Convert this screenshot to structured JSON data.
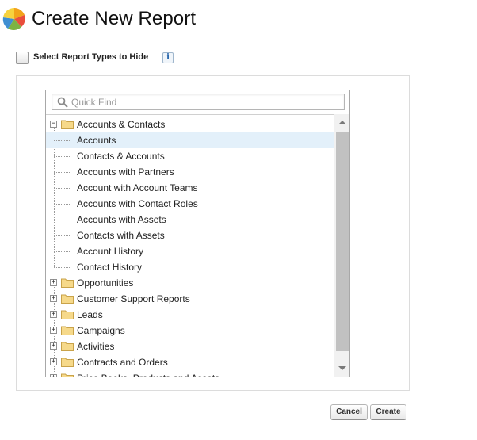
{
  "header": {
    "title": "Create New Report",
    "logo_icon": "salesforce-reports-logo"
  },
  "hide_types": {
    "label": "Select Report Types to Hide",
    "checked": false,
    "info_icon": "i"
  },
  "search": {
    "placeholder": "Quick Find",
    "value": "",
    "icon": "search-icon"
  },
  "tree": [
    {
      "label": "Accounts & Contacts",
      "type": "folder",
      "expanded": true,
      "expander": "−"
    },
    {
      "label": "Accounts",
      "type": "item",
      "selected": true
    },
    {
      "label": "Contacts & Accounts",
      "type": "item"
    },
    {
      "label": "Accounts with Partners",
      "type": "item"
    },
    {
      "label": "Account with Account Teams",
      "type": "item"
    },
    {
      "label": "Accounts with Contact Roles",
      "type": "item"
    },
    {
      "label": "Accounts with Assets",
      "type": "item"
    },
    {
      "label": "Contacts with Assets",
      "type": "item"
    },
    {
      "label": "Account History",
      "type": "item"
    },
    {
      "label": "Contact History",
      "type": "item"
    },
    {
      "label": "Opportunities",
      "type": "folder",
      "expanded": false,
      "expander": "+"
    },
    {
      "label": "Customer Support Reports",
      "type": "folder",
      "expanded": false,
      "expander": "+"
    },
    {
      "label": "Leads",
      "type": "folder",
      "expanded": false,
      "expander": "+"
    },
    {
      "label": "Campaigns",
      "type": "folder",
      "expanded": false,
      "expander": "+"
    },
    {
      "label": "Activities",
      "type": "folder",
      "expanded": false,
      "expander": "+"
    },
    {
      "label": "Contracts and Orders",
      "type": "folder",
      "expanded": false,
      "expander": "+"
    },
    {
      "label": "Price Books, Products and Assets",
      "type": "folder",
      "expanded": false,
      "expander": "+"
    }
  ],
  "colors": {
    "selected_row": "#e3f0fa",
    "folder_fill": "#f6d98a",
    "folder_stroke": "#c9a34a"
  },
  "buttons": {
    "cancel_label": "Cancel",
    "create_label": "Create"
  }
}
